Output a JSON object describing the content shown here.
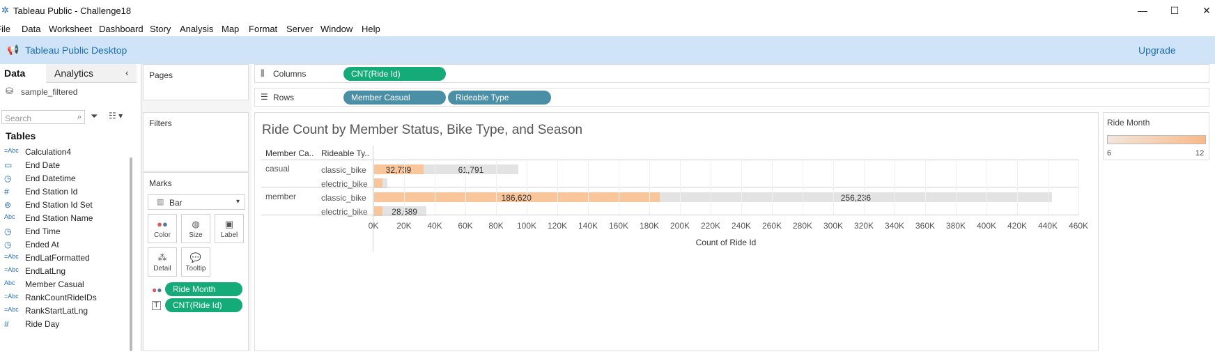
{
  "window": {
    "title": "Tableau Public - Challenge18",
    "controls": [
      "—",
      "☐",
      "✕"
    ]
  },
  "menu": [
    "File",
    "Data",
    "Worksheet",
    "Dashboard",
    "Story",
    "Analysis",
    "Map",
    "Format",
    "Server",
    "Window",
    "Help"
  ],
  "banner": {
    "title": "Tableau Public Desktop",
    "upgrade": "Upgrade"
  },
  "data_pane": {
    "tabs": [
      "Data",
      "Analytics"
    ],
    "datasource": "sample_filtered",
    "search_placeholder": "Search",
    "tables_heading": "Tables",
    "fields": [
      {
        "type": "=Abc",
        "name": "Calculation4"
      },
      {
        "type": "date",
        "name": "End Date"
      },
      {
        "type": "datetime",
        "name": "End Datetime"
      },
      {
        "type": "#",
        "name": "End Station Id"
      },
      {
        "type": "set",
        "name": "End Station Id Set"
      },
      {
        "type": "Abc",
        "name": "End Station Name"
      },
      {
        "type": "datetime",
        "name": "End Time"
      },
      {
        "type": "datetime",
        "name": "Ended At"
      },
      {
        "type": "=Abc",
        "name": "EndLatFormatted"
      },
      {
        "type": "=Abc",
        "name": "EndLatLng"
      },
      {
        "type": "Abc",
        "name": "Member Casual"
      },
      {
        "type": "=Abc",
        "name": "RankCountRideIDs"
      },
      {
        "type": "=Abc",
        "name": "RankStartLatLng"
      },
      {
        "type": "#",
        "name": "Ride Day"
      }
    ]
  },
  "cards": {
    "pages": "Pages",
    "filters": "Filters",
    "marks": "Marks",
    "mark_type": "Bar",
    "mark_buttons": [
      "Color",
      "Size",
      "Label",
      "Detail",
      "Tooltip"
    ],
    "mark_pills": [
      "Ride Month",
      "CNT(Ride Id)"
    ]
  },
  "shelves": {
    "columns_label": "Columns",
    "rows_label": "Rows",
    "columns_pills": [
      "CNT(Ride Id)"
    ],
    "rows_pills": [
      "Member Casual",
      "Rideable Type"
    ]
  },
  "colors": {
    "pill_measure": "#14ab78",
    "pill_dimension": "#4b8fa6",
    "bar_low": "#f9c59a",
    "bar_high": "#e3e3e3",
    "banner": "#cfe4f6"
  },
  "legend": {
    "title": "Ride Month",
    "min": "6",
    "max": "12"
  },
  "chart_data": {
    "type": "bar",
    "title": "Ride Count by Member Status, Bike Type, and Season",
    "row_headers": [
      "Member Ca..",
      "Rideable Ty.."
    ],
    "xlabel": "Count of Ride Id",
    "xlim": [
      0,
      460000
    ],
    "ticks": [
      "0K",
      "20K",
      "40K",
      "60K",
      "80K",
      "100K",
      "120K",
      "140K",
      "160K",
      "180K",
      "200K",
      "220K",
      "240K",
      "260K",
      "280K",
      "300K",
      "320K",
      "340K",
      "360K",
      "380K",
      "400K",
      "420K",
      "440K",
      "460K"
    ],
    "groups": [
      {
        "member": "casual",
        "rows": [
          {
            "type": "classic_bike",
            "segments": [
              {
                "value": 32739,
                "label": "32,739",
                "color": "#f9c59a"
              },
              {
                "value": 61791,
                "label": "61,791",
                "color": "#e3e3e3"
              }
            ]
          },
          {
            "type": "electric_bike",
            "segments": [
              {
                "value": 6000,
                "label": "",
                "color": "#f9c59a"
              },
              {
                "value": 3000,
                "label": "",
                "color": "#e3e3e3"
              }
            ]
          }
        ]
      },
      {
        "member": "member",
        "rows": [
          {
            "type": "classic_bike",
            "segments": [
              {
                "value": 186620,
                "label": "186,620",
                "color": "#f9c59a"
              },
              {
                "value": 256236,
                "label": "256,236",
                "color": "#e3e3e3"
              }
            ]
          },
          {
            "type": "electric_bike",
            "segments": [
              {
                "value": 6000,
                "label": "",
                "color": "#f9c59a"
              },
              {
                "value": 28589,
                "label": "28,589",
                "color": "#e3e3e3"
              }
            ]
          }
        ]
      }
    ]
  }
}
